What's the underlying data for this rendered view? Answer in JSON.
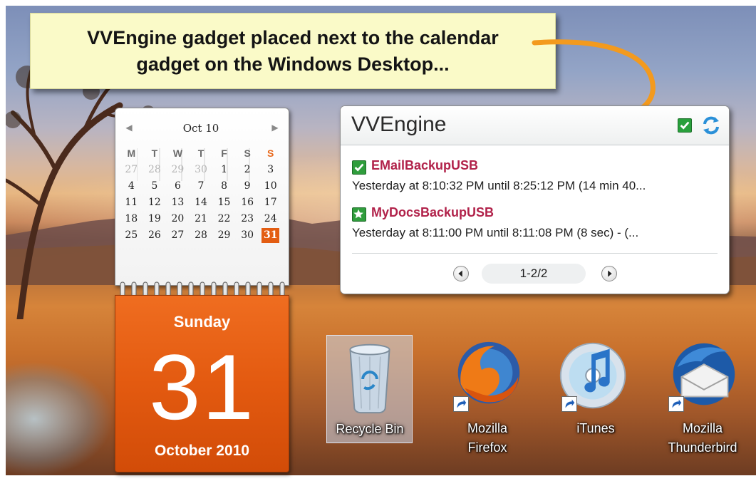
{
  "callout": {
    "text": "VVEngine gadget placed next to the calendar gadget on the Windows Desktop..."
  },
  "calendar": {
    "month_label": "Oct 10",
    "weekdays": [
      "M",
      "T",
      "W",
      "T",
      "F",
      "S",
      "S"
    ],
    "weeks": [
      [
        "27",
        "28",
        "29",
        "30",
        "1",
        "2",
        "3"
      ],
      [
        "4",
        "5",
        "6",
        "7",
        "8",
        "9",
        "10"
      ],
      [
        "11",
        "12",
        "13",
        "14",
        "15",
        "16",
        "17"
      ],
      [
        "18",
        "19",
        "20",
        "21",
        "22",
        "23",
        "24"
      ],
      [
        "25",
        "26",
        "27",
        "28",
        "29",
        "30",
        "31"
      ]
    ],
    "today": "31",
    "day_name": "Sunday",
    "day_number": "31",
    "month_year": "October 2010",
    "accent_color": "#e35d12"
  },
  "vvengine": {
    "title": "VVEngine",
    "jobs": [
      {
        "icon": "check-icon",
        "name": "EMailBackupUSB",
        "detail": "Yesterday at 8:10:32 PM until 8:25:12 PM (14 min 40..."
      },
      {
        "icon": "star-icon",
        "name": "MyDocsBackupUSB",
        "detail": "Yesterday at 8:11:00 PM until 8:11:08 PM (8 sec) - (..."
      }
    ],
    "pager": "1-2/2",
    "name_color": "#b1224a"
  },
  "desktop_icons": [
    {
      "label_lines": [
        "Recycle Bin"
      ],
      "icon": "recycle-bin-icon",
      "selected": true
    },
    {
      "label_lines": [
        "Mozilla",
        "Firefox"
      ],
      "icon": "firefox-icon",
      "selected": false
    },
    {
      "label_lines": [
        "iTunes"
      ],
      "icon": "itunes-icon",
      "selected": false
    },
    {
      "label_lines": [
        "Mozilla",
        "Thunderbird"
      ],
      "icon": "thunderbird-icon",
      "selected": false
    }
  ]
}
